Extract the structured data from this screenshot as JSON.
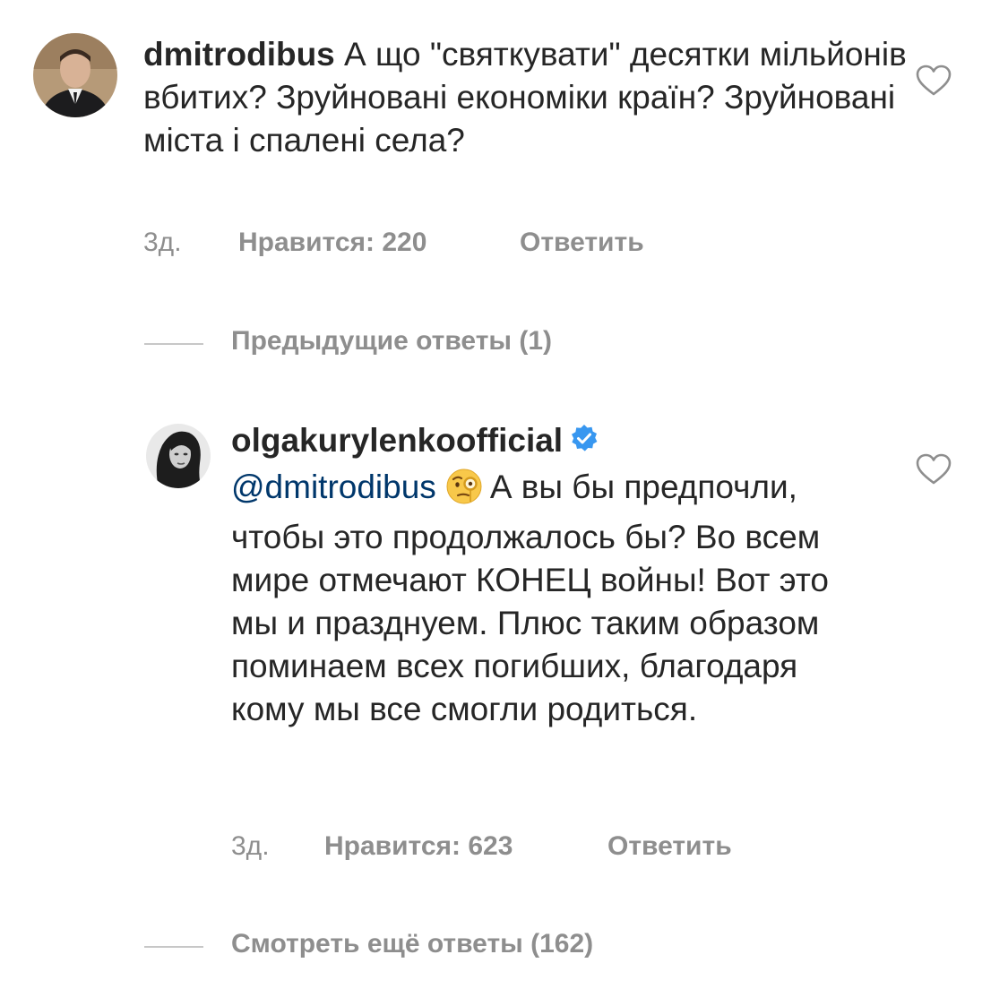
{
  "comments": [
    {
      "username": "dmitrodibus",
      "text": "А що \"святкувати\" десятки мільйонів вбитих? Зруйновані економіки країн? Зруйновані міста і спалені села?",
      "time": "3д.",
      "likes": "Нравится: 220",
      "reply": "Ответить",
      "verified": false
    },
    {
      "username": "olgakurylenkoofficial",
      "mention": "@dmitrodibus",
      "emoji": "face-with-monocle-icon",
      "text": "А вы бы предпочли, чтобы это продолжалось бы? Во всем мире отмечают КОНЕЦ войны! Вот это мы и празднуем. Плюс таким образом поминаем всех погибших, благодаря кому мы все смогли родиться.",
      "time": "3д.",
      "likes": "Нравится: 623",
      "reply": "Ответить",
      "verified": true
    }
  ],
  "previous_replies": "Предыдущие ответы (1)",
  "more_replies": "Смотреть ещё ответы (162)",
  "colors": {
    "text": "#262626",
    "muted": "#8e8e8e",
    "mention": "#00376b",
    "verified": "#3897f0"
  }
}
